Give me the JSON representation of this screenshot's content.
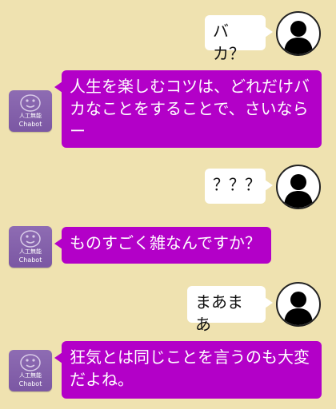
{
  "colors": {
    "background": "#efe2b0",
    "bot_bubble": "#b300c8",
    "user_bubble": "#ffffff",
    "bot_avatar": "#7b57a3"
  },
  "bot": {
    "name_jp": "人工無能",
    "name_en": "Chabot",
    "icon": "smiley-face-icon"
  },
  "user": {
    "icon": "person-silhouette-icon"
  },
  "messages": [
    {
      "sender": "user",
      "text": "バカ？"
    },
    {
      "sender": "bot",
      "text": "人生を楽しむコツは、どれだけバカなことをすることで、さいならー"
    },
    {
      "sender": "user",
      "text": "？？？"
    },
    {
      "sender": "bot",
      "text": "ものすごく雑なんですか？"
    },
    {
      "sender": "user",
      "text": "まあまあ"
    },
    {
      "sender": "bot",
      "text": "狂気とは同じことを言うのも大変だよね。"
    }
  ]
}
